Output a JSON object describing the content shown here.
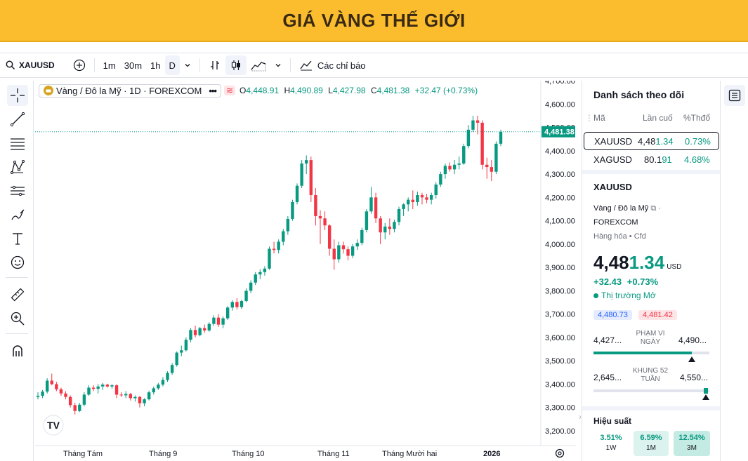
{
  "banner": {
    "title": "GIÁ VÀNG THẾ GIỚI"
  },
  "toolbar": {
    "symbol": "XAUUSD",
    "intervals": [
      "1m",
      "30m",
      "1h",
      "D"
    ],
    "indicators_label": "Các chỉ báo"
  },
  "legend": {
    "name": "Vàng / Đô la Mỹ · 1D · FOREXCOM",
    "o_label": "O",
    "o": "4,448.91",
    "h_label": "H",
    "h": "4,490.89",
    "l_label": "L",
    "l": "4,427.98",
    "c_label": "C",
    "c": "4,481.38",
    "change": "+32.47 (+0.73%)"
  },
  "price_axis": {
    "ticks": [
      "4,700.00",
      "4,600.00",
      "4,500.00",
      "4,400.00",
      "4,300.00",
      "4,200.00",
      "4,100.00",
      "4,000.00",
      "3,900.00",
      "3,800.00",
      "3,700.00",
      "3,600.00",
      "3,500.00",
      "3,400.00",
      "3,300.00",
      "3,200.00"
    ],
    "last_price": "4,481.38"
  },
  "time_axis": {
    "labels": [
      "Tháng Tám",
      "Tháng 9",
      "Tháng 10",
      "Tháng 11",
      "Tháng Mười hai",
      "2026"
    ]
  },
  "chart_data": {
    "type": "candlestick",
    "ylim": [
      3200,
      4700
    ],
    "candles": [
      [
        3345,
        3365,
        3335,
        3350
      ],
      [
        3350,
        3375,
        3340,
        3368
      ],
      [
        3368,
        3425,
        3360,
        3415
      ],
      [
        3415,
        3445,
        3395,
        3400
      ],
      [
        3400,
        3410,
        3370,
        3378
      ],
      [
        3378,
        3385,
        3350,
        3360
      ],
      [
        3360,
        3370,
        3335,
        3345
      ],
      [
        3345,
        3352,
        3300,
        3310
      ],
      [
        3310,
        3320,
        3270,
        3285
      ],
      [
        3285,
        3320,
        3280,
        3312
      ],
      [
        3312,
        3365,
        3305,
        3355
      ],
      [
        3355,
        3395,
        3350,
        3385
      ],
      [
        3385,
        3395,
        3370,
        3380
      ],
      [
        3380,
        3400,
        3360,
        3390
      ],
      [
        3390,
        3405,
        3375,
        3398
      ],
      [
        3398,
        3402,
        3385,
        3390
      ],
      [
        3390,
        3400,
        3380,
        3395
      ],
      [
        3395,
        3400,
        3340,
        3355
      ],
      [
        3355,
        3365,
        3345,
        3352
      ],
      [
        3352,
        3370,
        3340,
        3358
      ],
      [
        3358,
        3362,
        3330,
        3340
      ],
      [
        3340,
        3352,
        3325,
        3345
      ],
      [
        3345,
        3350,
        3300,
        3318
      ],
      [
        3318,
        3340,
        3305,
        3335
      ],
      [
        3335,
        3372,
        3330,
        3365
      ],
      [
        3365,
        3390,
        3355,
        3382
      ],
      [
        3382,
        3405,
        3375,
        3398
      ],
      [
        3398,
        3430,
        3390,
        3418
      ],
      [
        3418,
        3455,
        3410,
        3448
      ],
      [
        3448,
        3490,
        3440,
        3482
      ],
      [
        3482,
        3540,
        3475,
        3535
      ],
      [
        3535,
        3565,
        3520,
        3545
      ],
      [
        3545,
        3600,
        3540,
        3590
      ],
      [
        3590,
        3640,
        3580,
        3632
      ],
      [
        3632,
        3650,
        3600,
        3610
      ],
      [
        3610,
        3645,
        3605,
        3640
      ],
      [
        3640,
        3655,
        3620,
        3630
      ],
      [
        3630,
        3665,
        3625,
        3658
      ],
      [
        3658,
        3695,
        3650,
        3685
      ],
      [
        3685,
        3700,
        3645,
        3655
      ],
      [
        3655,
        3690,
        3640,
        3682
      ],
      [
        3682,
        3735,
        3675,
        3728
      ],
      [
        3728,
        3760,
        3715,
        3752
      ],
      [
        3752,
        3768,
        3720,
        3730
      ],
      [
        3730,
        3762,
        3722,
        3756
      ],
      [
        3756,
        3810,
        3750,
        3800
      ],
      [
        3800,
        3845,
        3790,
        3835
      ],
      [
        3835,
        3880,
        3825,
        3870
      ],
      [
        3870,
        3892,
        3850,
        3880
      ],
      [
        3880,
        3905,
        3865,
        3895
      ],
      [
        3895,
        3990,
        3890,
        3980
      ],
      [
        3980,
        4010,
        3960,
        3975
      ],
      [
        3975,
        4020,
        3960,
        4010
      ],
      [
        4010,
        4065,
        3995,
        4055
      ],
      [
        4055,
        4120,
        4040,
        4108
      ],
      [
        4108,
        4190,
        4100,
        4180
      ],
      [
        4180,
        4260,
        4170,
        4250
      ],
      [
        4250,
        4360,
        4240,
        4345
      ],
      [
        4345,
        4380,
        4300,
        4360
      ],
      [
        4360,
        4375,
        4180,
        4210
      ],
      [
        4210,
        4240,
        4080,
        4120
      ],
      [
        4120,
        4145,
        4000,
        4110
      ],
      [
        4110,
        4140,
        4060,
        4080
      ],
      [
        4080,
        4085,
        3950,
        3980
      ],
      [
        3980,
        4020,
        3890,
        3935
      ],
      [
        3935,
        4010,
        3920,
        3995
      ],
      [
        3995,
        4010,
        3960,
        3978
      ],
      [
        3978,
        3990,
        3930,
        3950
      ],
      [
        3950,
        4000,
        3940,
        3990
      ],
      [
        3990,
        4020,
        3975,
        4005
      ],
      [
        4005,
        4070,
        3995,
        4060
      ],
      [
        4060,
        4150,
        4050,
        4140
      ],
      [
        4140,
        4245,
        4130,
        4200
      ],
      [
        4200,
        4220,
        4090,
        4110
      ],
      [
        4110,
        4120,
        4000,
        4050
      ],
      [
        4050,
        4090,
        4020,
        4075
      ],
      [
        4075,
        4110,
        4040,
        4065
      ],
      [
        4065,
        4105,
        4050,
        4095
      ],
      [
        4095,
        4160,
        4080,
        4150
      ],
      [
        4150,
        4175,
        4120,
        4170
      ],
      [
        4170,
        4200,
        4140,
        4190
      ],
      [
        4190,
        4230,
        4150,
        4180
      ],
      [
        4180,
        4225,
        4165,
        4210
      ],
      [
        4210,
        4220,
        4170,
        4200
      ],
      [
        4200,
        4215,
        4175,
        4190
      ],
      [
        4190,
        4220,
        4170,
        4210
      ],
      [
        4210,
        4265,
        4195,
        4255
      ],
      [
        4255,
        4310,
        4245,
        4300
      ],
      [
        4300,
        4345,
        4280,
        4335
      ],
      [
        4335,
        4350,
        4310,
        4320
      ],
      [
        4320,
        4360,
        4300,
        4340
      ],
      [
        4340,
        4375,
        4320,
        4345
      ],
      [
        4345,
        4430,
        4340,
        4420
      ],
      [
        4420,
        4510,
        4410,
        4490
      ],
      [
        4490,
        4550,
        4480,
        4530
      ],
      [
        4530,
        4550,
        4470,
        4520
      ],
      [
        4520,
        4530,
        4320,
        4340
      ],
      [
        4340,
        4370,
        4280,
        4330
      ],
      [
        4330,
        4360,
        4270,
        4310
      ],
      [
        4310,
        4440,
        4300,
        4430
      ],
      [
        4430,
        4490,
        4420,
        4481
      ]
    ]
  },
  "watchlist": {
    "title": "Danh sách theo dõi",
    "col_symbol": "Mã",
    "col_last": "Lần cuố",
    "col_change": "%Thđổ",
    "rows": [
      {
        "symbol": "XAUUSD",
        "last_a": "4,48",
        "last_b": "1.34",
        "change": "0.73%"
      },
      {
        "symbol": "XAGUSD",
        "last_a": "80.1",
        "last_b": "91",
        "change": "4.68%"
      }
    ]
  },
  "details": {
    "symbol": "XAUUSD",
    "name": "Vàng / Đô la Mỹ",
    "exchange": "FOREXCOM",
    "category": "Hàng hóa",
    "type": "Cfd",
    "price_a": "4,48",
    "price_b": "1.34",
    "currency": "USD",
    "change": "+32.43",
    "change_pct": "+0.73%",
    "market_status": "Thị trường Mở",
    "bid": "4,480.73",
    "ask": "4,481.42",
    "day_low": "4,427...",
    "day_high": "4,490...",
    "day_range_label_1": "PHẠM VI",
    "day_range_label_2": "NGÀY",
    "day_range_fraction": 0.85,
    "w52_low": "2,645...",
    "w52_high": "4,550...",
    "w52_label_1": "KHUNG 52",
    "w52_label_2": "TUẦN",
    "w52_fraction": 0.97,
    "perf_title": "Hiệu suất",
    "perf": [
      {
        "value": "3.51%",
        "label": "1W"
      },
      {
        "value": "6.59%",
        "label": "1M"
      },
      {
        "value": "12.54%",
        "label": "3M"
      }
    ]
  }
}
